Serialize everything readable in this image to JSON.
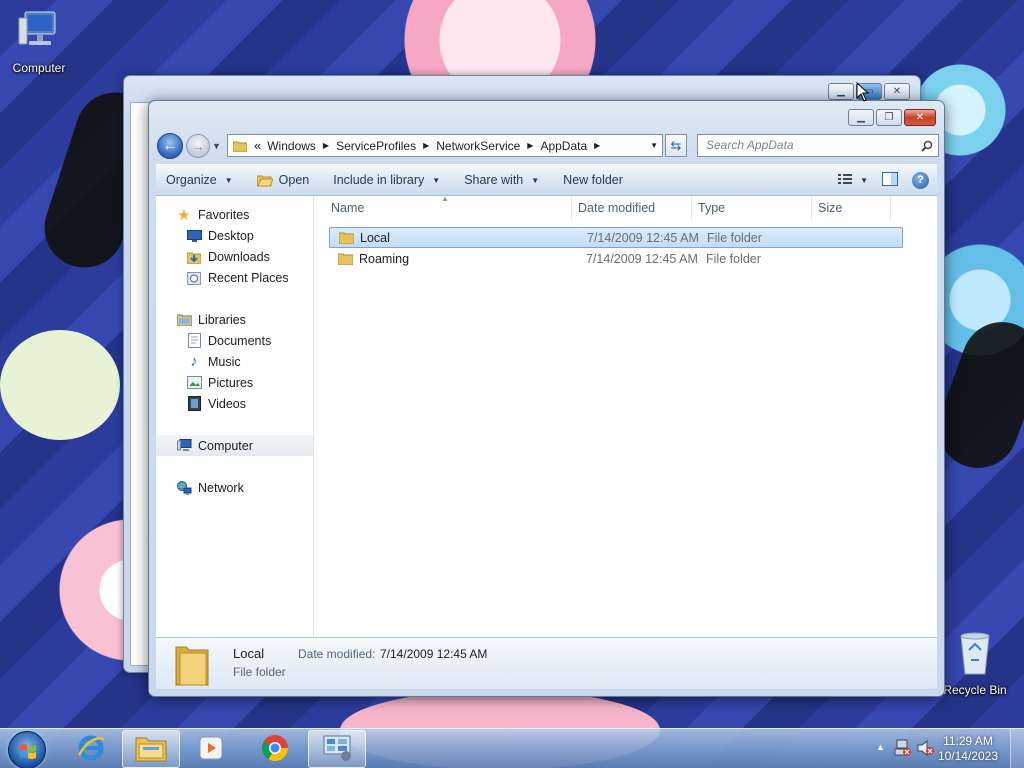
{
  "desktop": {
    "icons": [
      {
        "label": "Computer",
        "icon": "computer-icon"
      },
      {
        "label": "Recycle Bin",
        "icon": "recycle-bin-icon"
      }
    ]
  },
  "window": {
    "address": {
      "overflow": "«",
      "crumbs": [
        "Windows",
        "ServiceProfiles",
        "NetworkService",
        "AppData"
      ]
    },
    "search_placeholder": "Search AppData",
    "toolbar": {
      "organize": "Organize",
      "open": "Open",
      "include_in_library": "Include in library",
      "share_with": "Share with",
      "new_folder": "New folder"
    },
    "nav_pane": {
      "favorites": "Favorites",
      "favorites_items": [
        "Desktop",
        "Downloads",
        "Recent Places"
      ],
      "libraries": "Libraries",
      "libraries_items": [
        "Documents",
        "Music",
        "Pictures",
        "Videos"
      ],
      "computer": "Computer",
      "network": "Network"
    },
    "columns": [
      "Name",
      "Date modified",
      "Type",
      "Size"
    ],
    "files": [
      {
        "name": "Local",
        "date": "7/14/2009 12:45 AM",
        "type": "File folder",
        "selected": true
      },
      {
        "name": "Roaming",
        "date": "7/14/2009 12:45 AM",
        "type": "File folder",
        "selected": false
      }
    ],
    "details": {
      "name": "Local",
      "type": "File folder",
      "date_label": "Date modified:",
      "date_value": "7/14/2009 12:45 AM"
    }
  },
  "taskbar": {
    "apps": [
      "start-orb",
      "internet-explorer-icon",
      "windows-explorer-icon",
      "media-player-icon",
      "chrome-icon",
      "control-panel-icon"
    ],
    "time": "11:29 AM",
    "date": "10/14/2023"
  },
  "colors": {
    "accent": "#2a63b8",
    "selection": "#c1dcfa",
    "close_button": "#c7442c"
  }
}
